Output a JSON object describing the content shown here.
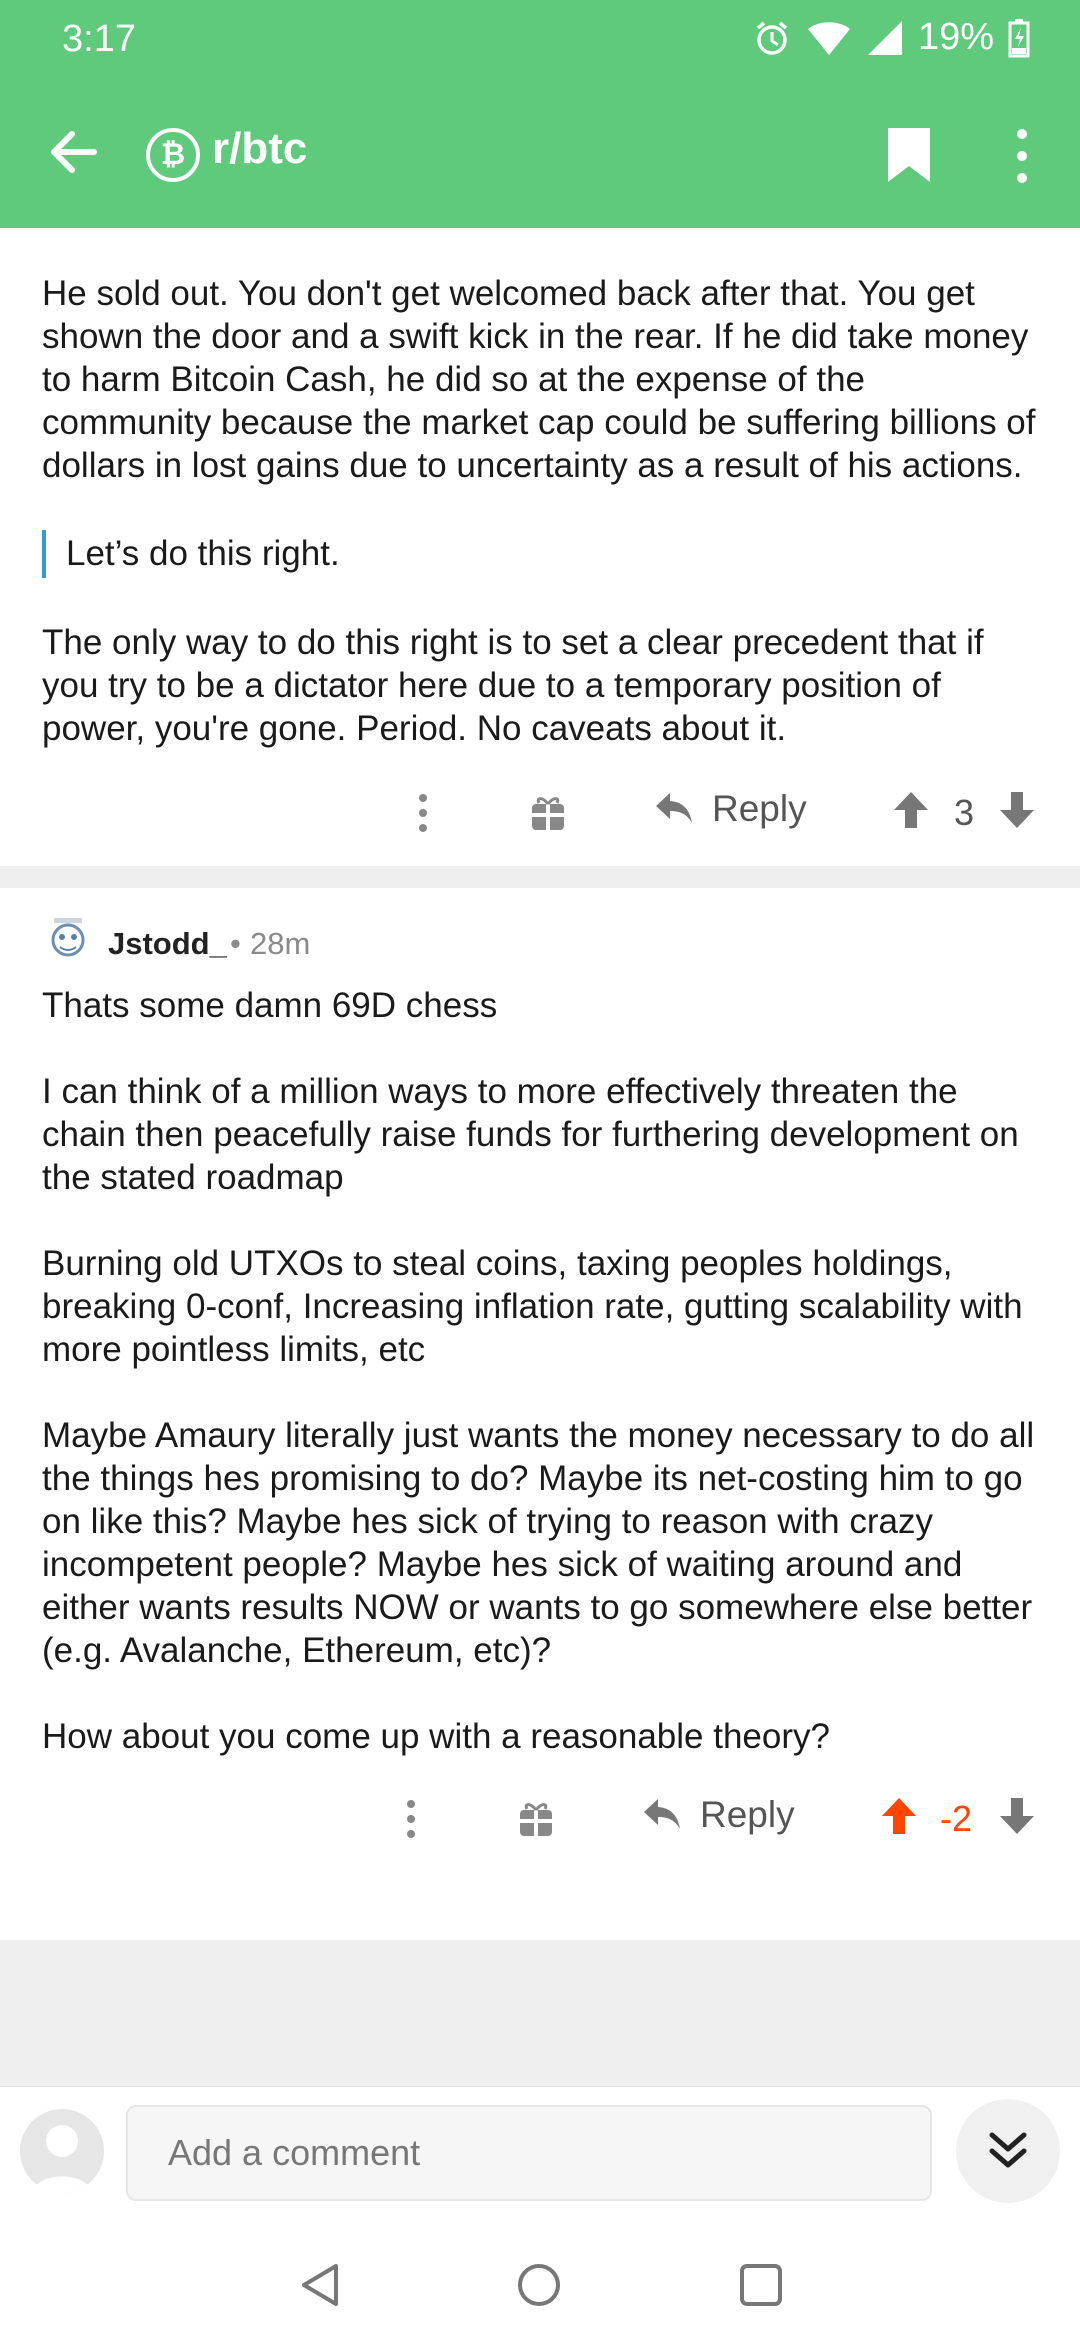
{
  "status": {
    "time": "3:17",
    "battery": "19%"
  },
  "appbar": {
    "subreddit": "r/btc",
    "sub_icon_glyph": "₿"
  },
  "comment1": {
    "paragraphs": [
      "He sold out. You don't get welcomed back after that. You get shown the door and a swift kick in the rear. If he did take money to harm Bitcoin Cash, he did so at the expense of the community because the market cap could be suffering billions of dollars in lost gains due to uncertainty as a result of his actions.",
      "The only way to do this right is to set a clear precedent that if you try to be a dictator here due to a temporary position of power, you're gone. Period. No caveats about it."
    ],
    "quote": "Let’s do this right.",
    "reply_label": "Reply",
    "score": "3"
  },
  "comment2": {
    "author": "Jstodd_",
    "separator": "•",
    "time": "28m",
    "paragraphs": [
      "Thats some damn 69D chess",
      "I can think of a million ways to more effectively threaten the chain then peacefully raise funds for furthering development on the stated roadmap",
      "Burning old UTXOs to steal coins, taxing peoples holdings, breaking 0-conf, Increasing inflation rate, gutting scalability with more pointless limits, etc",
      "Maybe Amaury literally just wants the money necessary to do all the things hes promising to do? Maybe its net-costing him to go on like this? Maybe hes sick of trying to reason with crazy incompetent people? Maybe hes sick of waiting around and either wants results NOW or wants to go somewhere else better (e.g. Avalanche, Ethereum, etc)?",
      "How about you come up with a reasonable theory?"
    ],
    "reply_label": "Reply",
    "score": "-2",
    "score_color": "#ff4500"
  },
  "composer": {
    "placeholder": "Add a comment"
  },
  "colors": {
    "appbar": "#5fca7b",
    "quote_bar": "#3a97d8",
    "upvote_active": "#ff4500"
  }
}
